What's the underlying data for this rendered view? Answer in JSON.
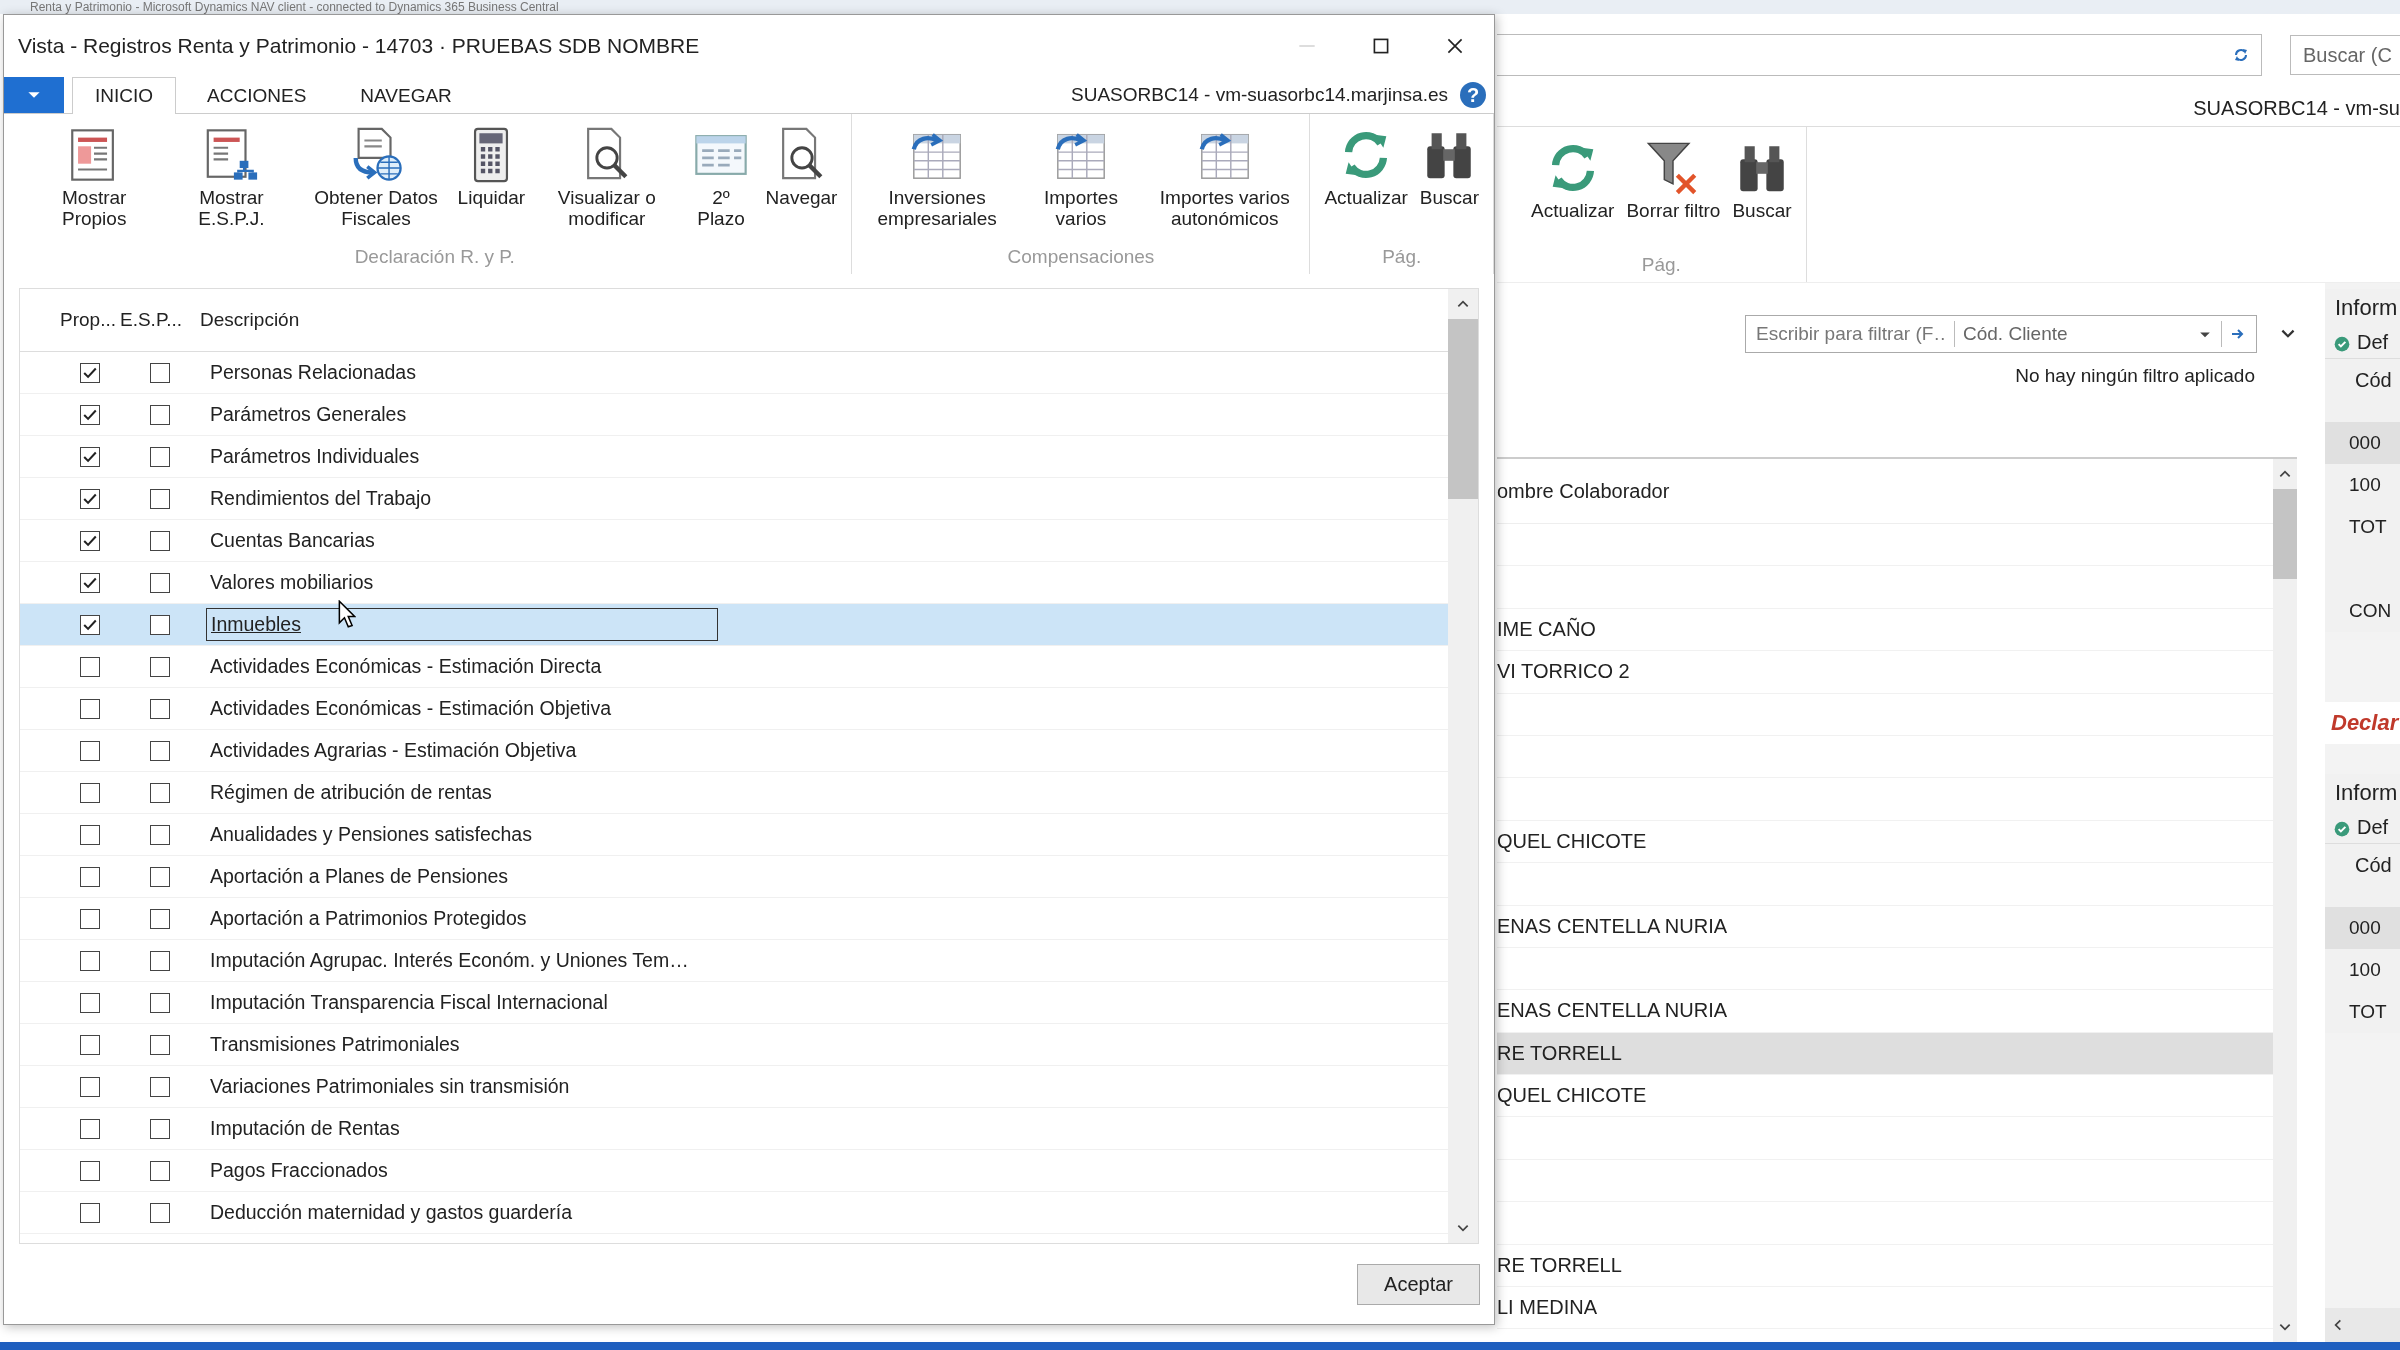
{
  "background_window": {
    "title": "Renta y Patrimonio - Microsoft Dynamics NAV client - connected to Dynamics 365 Business Central",
    "search": {
      "placeholder": "Buscar (C"
    },
    "server": "SUASORBC14 - vm-su",
    "ribbon": {
      "group": "Pág.",
      "buttons": [
        {
          "label": "Actualizar",
          "kind": "refresh"
        },
        {
          "label": "Borrar filtro",
          "kind": "filter-clear"
        },
        {
          "label": "Buscar",
          "kind": "binoculars"
        }
      ]
    },
    "filter": {
      "placeholder": "Escribir para filtrar (F…",
      "field": "Cód. Cliente"
    },
    "filter_status": "No hay ningún filtro aplicado",
    "list": {
      "column": "ombre Colaborador",
      "rows": [
        {
          "selected": false
        },
        {
          "selected": false
        },
        {
          "name": "IME CAÑO",
          "selected": false
        },
        {
          "name": "VI TORRICO 2",
          "selected": false
        },
        {
          "selected": false
        },
        {
          "selected": false
        },
        {
          "selected": false
        },
        {
          "name": "QUEL CHICOTE",
          "selected": false
        },
        {
          "selected": false
        },
        {
          "name": "ENAS CENTELLA NURIA",
          "selected": false
        },
        {
          "selected": false
        },
        {
          "name": "ENAS CENTELLA NURIA",
          "selected": false
        },
        {
          "name": "RE TORRELL",
          "selected": true
        },
        {
          "name": "QUEL CHICOTE",
          "selected": false
        },
        {
          "selected": false
        },
        {
          "selected": false
        },
        {
          "selected": false
        },
        {
          "name": "RE TORRELL",
          "selected": false
        },
        {
          "name": "LI MEDINA",
          "selected": false
        }
      ]
    },
    "factbox": [
      {
        "kind": "panel",
        "title": "Inform",
        "link": "Def",
        "column": "Cód",
        "rows": [
          {
            "kind": "value",
            "text": "000",
            "selected": true
          },
          {
            "kind": "value",
            "text": "100",
            "selected": false
          },
          {
            "kind": "value",
            "text": "TOT",
            "selected": false
          },
          {
            "kind": "blank"
          },
          {
            "kind": "value",
            "text": "CON",
            "selected": false
          }
        ]
      },
      {
        "kind": "heading",
        "title": "Declar"
      },
      {
        "kind": "panel",
        "title": "Inform",
        "link": "Def",
        "column": "Cód",
        "rows": [
          {
            "kind": "value",
            "text": "000",
            "selected": true
          },
          {
            "kind": "value",
            "text": "100",
            "selected": false
          },
          {
            "kind": "value",
            "text": "TOT",
            "selected": false
          }
        ]
      }
    ]
  },
  "dialog": {
    "title": "Vista - Registros Renta y Patrimonio - 14703 · PRUEBAS SDB NOMBRE",
    "tabs": [
      {
        "label": "INICIO",
        "selected": true
      },
      {
        "label": "ACCIONES",
        "selected": false
      },
      {
        "label": "NAVEGAR",
        "selected": false
      }
    ],
    "server": "SUASORBC14 - vm-suasorbc14.marjinsa.es",
    "help": "?",
    "ribbon": [
      {
        "label": "Declaración R. y P.",
        "buttons": [
          {
            "label": "Mostrar Propios",
            "kind": "report"
          },
          {
            "label": "Mostrar E.S.P.J.",
            "kind": "hierarchy"
          },
          {
            "label": "Obtener Datos Fiscales",
            "kind": "globe"
          },
          {
            "label": "Liquidar",
            "kind": "calculator"
          },
          {
            "label": "Visualizar o modificar",
            "kind": "magnify"
          },
          {
            "label": "2º Plazo",
            "kind": "calendar"
          },
          {
            "label": "Navegar",
            "kind": "magnify"
          }
        ]
      },
      {
        "label": "Compensaciones",
        "buttons": [
          {
            "label": "Inversiones empresariales",
            "kind": "grid"
          },
          {
            "label": "Importes varios",
            "kind": "grid"
          },
          {
            "label": "Importes varios autonómicos",
            "kind": "grid"
          }
        ]
      },
      {
        "label": "Pág.",
        "buttons": [
          {
            "label": "Actualizar",
            "kind": "refresh"
          },
          {
            "label": "Buscar",
            "kind": "binoculars"
          }
        ]
      }
    ],
    "columns": [
      "Prop...",
      "E.S.P...",
      "Descripción"
    ],
    "rows": [
      {
        "prop": true,
        "esp": false,
        "label": "Personas Relacionadas",
        "selected": false
      },
      {
        "prop": true,
        "esp": false,
        "label": "Parámetros Generales",
        "selected": false
      },
      {
        "prop": true,
        "esp": false,
        "label": "Parámetros Individuales",
        "selected": false
      },
      {
        "prop": true,
        "esp": false,
        "label": "Rendimientos del Trabajo",
        "selected": false
      },
      {
        "prop": true,
        "esp": false,
        "label": "Cuentas Bancarias",
        "selected": false
      },
      {
        "prop": true,
        "esp": false,
        "label": "Valores mobiliarios",
        "selected": false
      },
      {
        "prop": true,
        "esp": false,
        "label": "Inmuebles",
        "selected": true
      },
      {
        "prop": false,
        "esp": false,
        "label": "Actividades Económicas - Estimación Directa",
        "selected": false
      },
      {
        "prop": false,
        "esp": false,
        "label": "Actividades Económicas - Estimación Objetiva",
        "selected": false
      },
      {
        "prop": false,
        "esp": false,
        "label": "Actividades Agrarias - Estimación Objetiva",
        "selected": false
      },
      {
        "prop": false,
        "esp": false,
        "label": "Régimen de atribución de rentas",
        "selected": false
      },
      {
        "prop": false,
        "esp": false,
        "label": "Anualidades y Pensiones satisfechas",
        "selected": false
      },
      {
        "prop": false,
        "esp": false,
        "label": "Aportación a Planes de Pensiones",
        "selected": false
      },
      {
        "prop": false,
        "esp": false,
        "label": "Aportación a Patrimonios Protegidos",
        "selected": false
      },
      {
        "prop": false,
        "esp": false,
        "label": "Imputación Agrupac. Interés Económ. y Uniones Tem…",
        "selected": false
      },
      {
        "prop": false,
        "esp": false,
        "label": "Imputación Transparencia Fiscal Internacional",
        "selected": false
      },
      {
        "prop": false,
        "esp": false,
        "label": "Transmisiones Patrimoniales",
        "selected": false
      },
      {
        "prop": false,
        "esp": false,
        "label": "Variaciones Patrimoniales sin transmisión",
        "selected": false
      },
      {
        "prop": false,
        "esp": false,
        "label": "Imputación de Rentas",
        "selected": false
      },
      {
        "prop": false,
        "esp": false,
        "label": "Pagos Fraccionados",
        "selected": false
      },
      {
        "prop": false,
        "esp": false,
        "label": "Deducción maternidad y gastos guardería",
        "selected": false
      }
    ],
    "ok_button": "Aceptar"
  }
}
